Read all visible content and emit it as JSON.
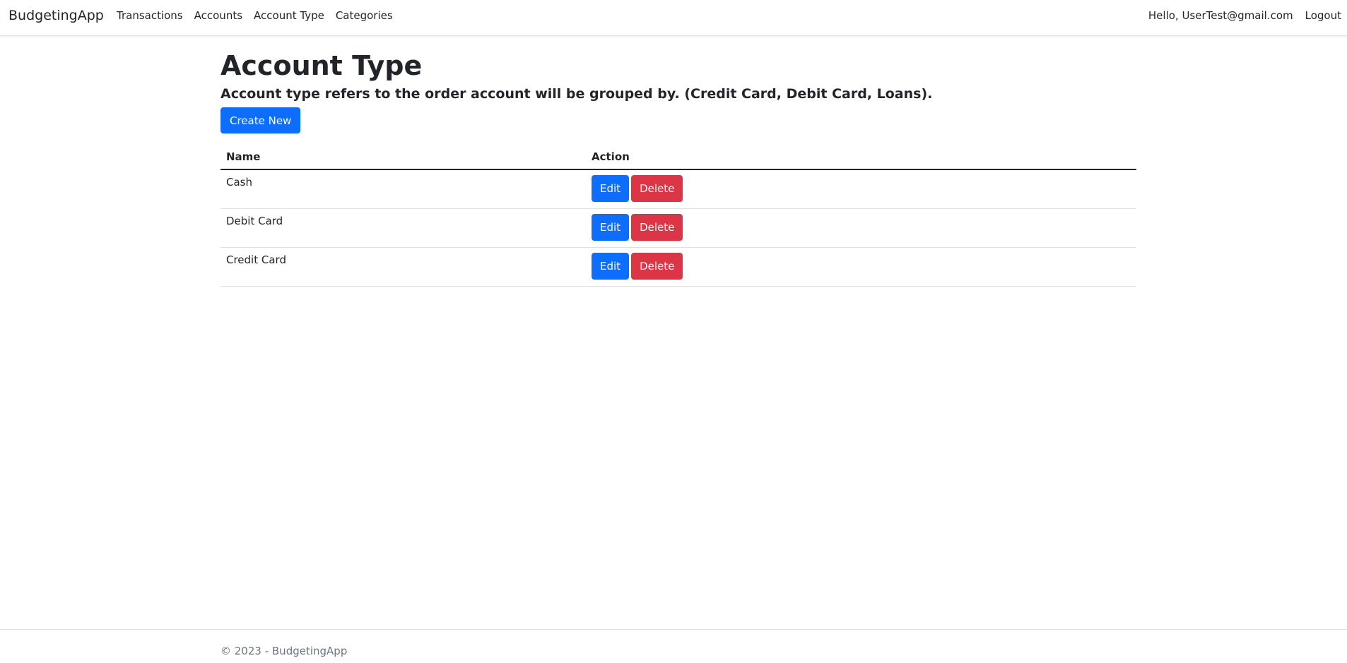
{
  "navbar": {
    "brand": "BudgetingApp",
    "links": [
      {
        "label": "Transactions"
      },
      {
        "label": "Accounts"
      },
      {
        "label": "Account Type"
      },
      {
        "label": "Categories"
      }
    ],
    "greeting": "Hello, UserTest@gmail.com",
    "logout": "Logout"
  },
  "main": {
    "title": "Account Type",
    "subtitle": "Account type refers to the order account will be grouped by. (Credit Card, Debit Card, Loans).",
    "create_label": "Create New",
    "table": {
      "headers": [
        "Name",
        "Action"
      ],
      "rows": [
        {
          "name": "Cash"
        },
        {
          "name": "Debit Card"
        },
        {
          "name": "Credit Card"
        }
      ],
      "edit_label": "Edit",
      "delete_label": "Delete"
    }
  },
  "footer": {
    "copyright": "© 2023 - ",
    "link": "BudgetingApp"
  },
  "colors": {
    "primary": "#0d6efd",
    "danger": "#dc3545",
    "text": "#212529",
    "muted": "#6c757d",
    "border": "#dee2e6"
  }
}
